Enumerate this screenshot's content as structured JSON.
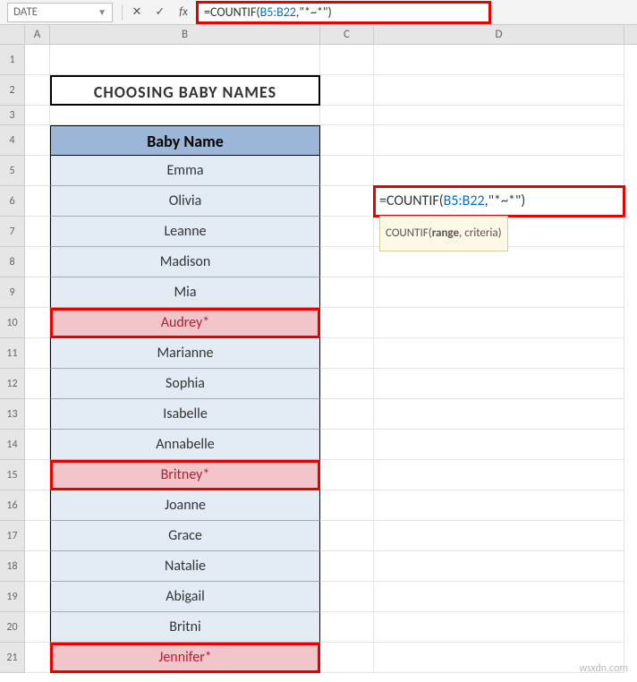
{
  "name_box": "DATE",
  "formula_bar": {
    "prefix": "=COUNTIF(",
    "range": "B5:B22",
    "suffix": ",\"*~*\")"
  },
  "columns": [
    "A",
    "B",
    "C",
    "D"
  ],
  "rows": [
    1,
    2,
    3,
    4,
    5,
    6,
    7,
    8,
    9,
    10,
    11,
    12,
    13,
    14,
    15,
    16,
    17,
    18,
    19,
    20,
    21
  ],
  "title": "CHOOSING BABY NAMES",
  "table_header": "Baby Name",
  "names": [
    {
      "v": "Emma",
      "star": false
    },
    {
      "v": "Olivia",
      "star": false
    },
    {
      "v": "Leanne",
      "star": false
    },
    {
      "v": "Madison",
      "star": false
    },
    {
      "v": "Mia",
      "star": false
    },
    {
      "v": "Audrey*",
      "star": true
    },
    {
      "v": "Marianne",
      "star": false
    },
    {
      "v": "Sophia",
      "star": false
    },
    {
      "v": "Isabelle",
      "star": false
    },
    {
      "v": "Annabelle",
      "star": false
    },
    {
      "v": "Britney*",
      "star": true
    },
    {
      "v": "Joanne",
      "star": false
    },
    {
      "v": "Grace",
      "star": false
    },
    {
      "v": "Natalie",
      "star": false
    },
    {
      "v": "Abigail",
      "star": false
    },
    {
      "v": "Britni",
      "star": false
    },
    {
      "v": "Jennifer*",
      "star": true
    }
  ],
  "cell_edit": {
    "prefix": "=COUNTIF(",
    "range": "B5:B22",
    "suffix": ",\"*~*\")"
  },
  "tooltip": {
    "fn": "COUNTIF",
    "arg1": "range",
    "arg2": "criteria"
  },
  "fb_icons": {
    "cancel": "✕",
    "confirm": "✓",
    "fx": "fx"
  },
  "watermark": "wsxdn.com"
}
